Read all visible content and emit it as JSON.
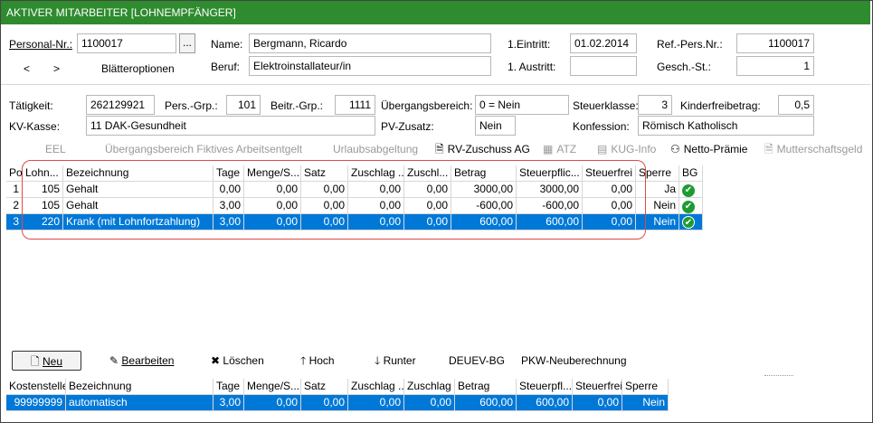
{
  "window": {
    "title": "AKTIVER MITARBEITER [LOHNEMPFÄNGER]"
  },
  "header": {
    "personal_nr_label": "Personal-Nr.:",
    "personal_nr_value": "1100017",
    "lookup_button": "...",
    "name_label": "Name:",
    "name_value": "Bergmann, Ricardo",
    "beruf_label": "Beruf:",
    "beruf_value": "Elektroinstallateur/in",
    "eintritt_label": "1.Eintritt:",
    "eintritt_value": "01.02.2014",
    "austritt_label": "1. Austritt:",
    "austritt_value": "",
    "ref_pers_label": "Ref.-Pers.Nr.:",
    "ref_pers_value": "1100017",
    "gesch_st_label": "Gesch.-St.:",
    "gesch_st_value": "1",
    "prev_label": "<",
    "next_label": ">",
    "blaetter_label": "Blätteroptionen"
  },
  "details": {
    "taetigkeit_label": "Tätigkeit:",
    "taetigkeit_value": "262129921",
    "pers_grp_label": "Pers.-Grp.:",
    "pers_grp_value": "101",
    "beitr_grp_label": "Beitr.-Grp.:",
    "beitr_grp_value": "1111",
    "uebergang_label": "Übergangsbereich:",
    "uebergang_value": "0 = Nein",
    "steuerklasse_label": "Steuerklasse:",
    "steuerklasse_value": "3",
    "kinderfrei_label": "Kinderfreibetrag:",
    "kinderfrei_value": "0,5",
    "kv_kasse_label": "KV-Kasse:",
    "kv_kasse_value": "11 DAK-Gesundheit",
    "pv_zusatz_label": "PV-Zusatz:",
    "pv_zusatz_value": "Nein",
    "konfession_label": "Konfession:",
    "konfession_value": "Römisch Katholisch"
  },
  "toolbar": {
    "eel": "EEL",
    "uebergang_fiktiv": "Übergangsbereich Fiktives Arbeitsentgelt",
    "urlaubsabgeltung": "Urlaubsabgeltung",
    "rv_zuschuss": "RV-Zuschuss AG",
    "atz": "ATZ",
    "kug_info": "KUG-Info",
    "netto_praemie": "Netto-Prämie",
    "mutterschaftsgeld": "Mutterschaftsgeld"
  },
  "lohn_table": {
    "columns": [
      "Pos",
      "Lohn...",
      "Bezeichnung",
      "Tage",
      "Menge/S...",
      "Satz",
      "Zuschlag ...",
      "Zuschl...",
      "Betrag",
      "Steuerpflic...",
      "Steuerfrei",
      "Sperre",
      "BG"
    ],
    "rows": [
      {
        "pos": "1",
        "lohnart": "105",
        "bezeichnung": "Gehalt",
        "tage": "0,00",
        "menge": "0,00",
        "satz": "0,00",
        "zuschlag": "0,00",
        "zuschl": "0,00",
        "betrag": "3000,00",
        "steuerpfl": "3000,00",
        "steuerfrei": "0,00",
        "sperre": "Ja",
        "bg": "check"
      },
      {
        "pos": "2",
        "lohnart": "105",
        "bezeichnung": "Gehalt",
        "tage": "3,00",
        "menge": "0,00",
        "satz": "0,00",
        "zuschlag": "0,00",
        "zuschl": "0,00",
        "betrag": "-600,00",
        "steuerpfl": "-600,00",
        "steuerfrei": "0,00",
        "sperre": "Nein",
        "bg": "check"
      },
      {
        "pos": "3",
        "lohnart": "220",
        "bezeichnung": "Krank (mit Lohnfortzahlung)",
        "tage": "3,00",
        "menge": "0,00",
        "satz": "0,00",
        "zuschlag": "0,00",
        "zuschl": "0,00",
        "betrag": "600,00",
        "steuerpfl": "600,00",
        "steuerfrei": "0,00",
        "sperre": "Nein",
        "bg": "check"
      }
    ]
  },
  "actions": {
    "neu": "Neu",
    "bearbeiten": "Bearbeiten",
    "loeschen": "Löschen",
    "hoch": "Hoch",
    "runter": "Runter",
    "deuev": "DEUEV-BG",
    "pkw": "PKW-Neuberechnung"
  },
  "kosten_table": {
    "columns": [
      "Kostenstelle",
      "Bezeichnung",
      "Tage",
      "Menge/S...",
      "Satz",
      "Zuschlag ...",
      "Zuschlag",
      "Betrag",
      "Steuerpfl...",
      "Steuerfrei",
      "Sperre"
    ],
    "rows": [
      {
        "kostenstelle": "99999999",
        "bezeichnung": "automatisch",
        "tage": "3,00",
        "menge": "0,00",
        "satz": "0,00",
        "zuschlag1": "0,00",
        "zuschlag2": "0,00",
        "betrag": "600,00",
        "steuerpfl": "600,00",
        "steuerfrei": "0,00",
        "sperre": "Nein"
      }
    ]
  },
  "colors": {
    "titlebar": "#2e8b2e",
    "selection": "#0078d7",
    "highlight": "#e04a4a",
    "check": "#1e9b32"
  }
}
